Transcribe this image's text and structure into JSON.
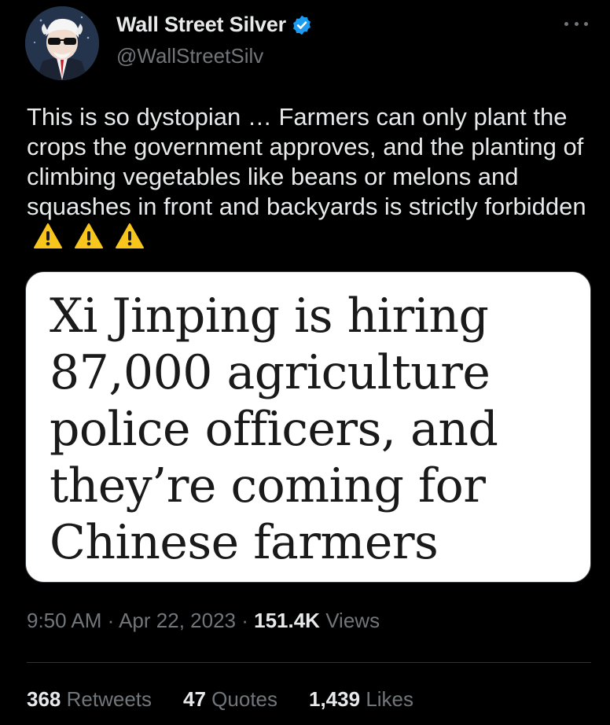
{
  "author": {
    "display_name": "Wall Street Silver",
    "handle": "@WallStreetSilv",
    "verified": true,
    "verified_color": "#1d9bf0"
  },
  "tweet": {
    "text": "This is so dystopian … Farmers can only plant the crops the government approves, and the planting of climbing vegetables like beans or melons and squashes in front and backyards is strictly forbidden",
    "emoji_icons": [
      "warning-icon",
      "warning-icon",
      "warning-icon"
    ]
  },
  "media": {
    "headline": "Xi Jinping is hiring 87,000 agriculture police officers, and they’re coming for Chinese farmers"
  },
  "meta": {
    "time": "9:50 AM",
    "separator": "·",
    "date": "Apr 22, 2023",
    "views_count": "151.4K",
    "views_label": "Views"
  },
  "stats": {
    "retweets_count": "368",
    "retweets_label": "Retweets",
    "quotes_count": "47",
    "quotes_label": "Quotes",
    "likes_count": "1,439",
    "likes_label": "Likes"
  },
  "colors": {
    "background": "#000000",
    "primary_text": "#e7e9ea",
    "secondary_text": "#71767b",
    "warning_yellow": "#f7c51c"
  }
}
